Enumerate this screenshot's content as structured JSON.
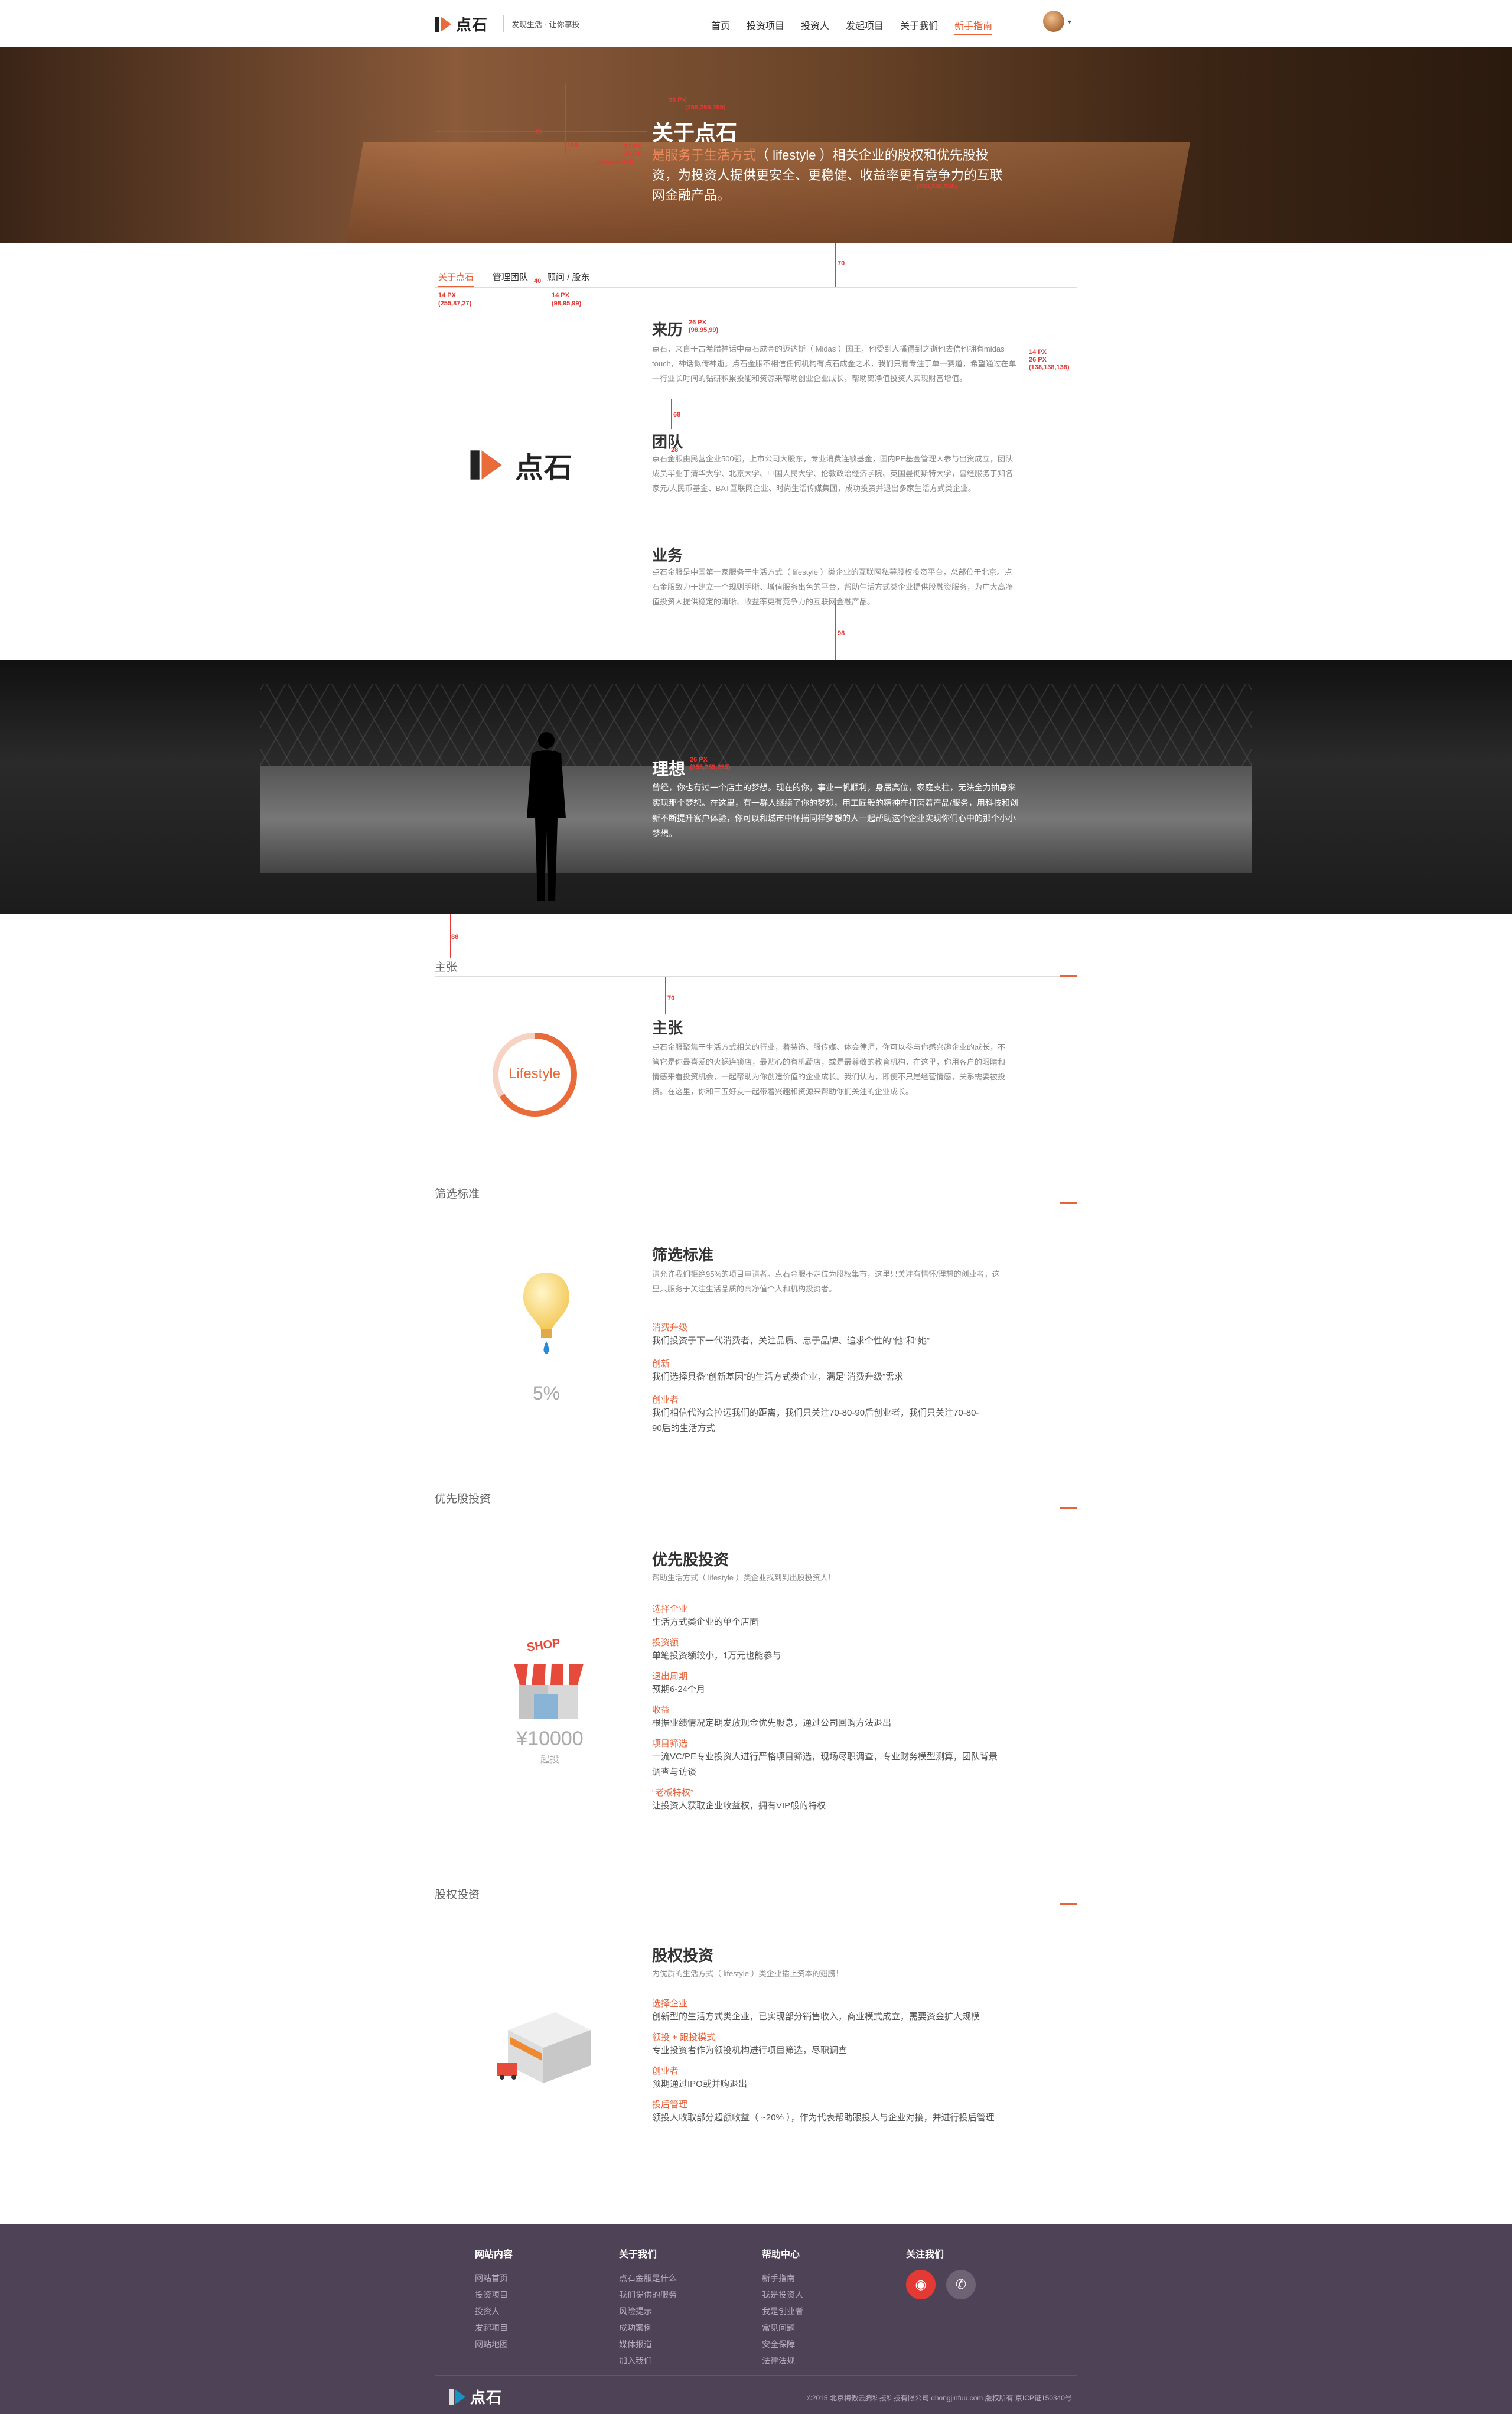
{
  "header": {
    "logo_text": "点石",
    "tagline": "发现生活 · 让你享投",
    "nav": [
      "首页",
      "投资项目",
      "投资人",
      "发起项目",
      "关于我们",
      "新手指南"
    ],
    "active_nav": "新手指南"
  },
  "hero": {
    "title": "关于点石",
    "text_highlight": "是服务于生活方式",
    "text_rest": "（ lifestyle ）相关企业的股权和优先股投资，为投资人提供更安全、更稳健、收益率更有竞争力的互联网金融产品。",
    "notes": [
      "36 PX",
      "(255,255,255)",
      "24 PX",
      "30 PX",
      "(255,194,54)",
      "(255,255,255)",
      "108",
      "76"
    ]
  },
  "subtabs": {
    "items": [
      "关于点石",
      "管理团队",
      "顾问 / 股东"
    ],
    "notes": [
      "14 PX",
      "(255,87,27)",
      "14 PX",
      "(98,95,99)",
      "40",
      "70"
    ]
  },
  "about": {
    "logo_text": "点石",
    "origin_title": "来历",
    "origin_text": "点石，来自于古希腊神话中点石成金的迈达斯（ Midas ）国王，他受到人播得到之逝他去信他拥有midas touch，神话似传神逝。点石金服不相信任何机构有点石成金之术，我们只有专注于单一赛道，希望通过在单一行业长时间的钻研积累投能和资源来帮助创业企业成长，帮助离净值投资人实现财富增值。",
    "team_title": "团队",
    "team_text": "点石金服由民营企业500强，上市公司大股东，专业消费连锁基金，国内PE基金管理人参与出资成立，团队成员毕业于清华大学、北京大学、中国人民大学、伦敦政治经济学院、英国曼彻斯特大学，曾经服务于知名家元/人民币基金、BAT互联网企业、时尚生活传媒集团，成功投资并退出多家生活方式类企业。",
    "business_title": "业务",
    "business_text": "点石金服是中国第一家服务于生活方式（ lifestyle ）类企业的互联网私募股权投资平台，总部位于北京。点石金服致力于建立一个规则明晰、增值服务出色的平台，帮助生活方式类企业提供股融资服务，为广大高净值投资人提供稳定的清晰、收益率更有竞争力的互联网金融产品。",
    "notes": [
      "26 PX",
      "(98,95,99)",
      "14 PX",
      "26 PX",
      "(138,138,138)",
      "68",
      "28",
      "98"
    ]
  },
  "dream": {
    "title": "理想",
    "text": "曾经，你也有过一个店主的梦想。现在的你，事业一帆顺利，身居高位，家庭支柱，无法全力抽身来实现那个梦想。在这里，有一群人继续了你的梦想，用工匠般的精神在打磨着产品/服务，用科技和创新不断提升客户体验，你可以和城市中怀揣同样梦想的人一起帮助这个企业实现你们心中的那个小小梦想。",
    "notes": [
      "26 PX",
      "(255,255,255)",
      "88"
    ]
  },
  "claim": {
    "section_label": "主张",
    "title": "主张",
    "badge": "Lifestyle",
    "text": "点石金服聚焦于生活方式相关的行业，着装饰、服传媒、体会律师，你可以参与你感兴趣企业的成长，不管它是你最喜爱的火锅连锁店，最贴心的有机蔬店，或是最尊敬的教育机构，在这里，你用客户的眼睛和情感来看投资机会，一起帮助为你创造价值的企业成长。我们认为，即使不只是经营情感，关系需要被投资。在这里，你和三五好友一起带着兴趣和资源来帮助你们关注的企业成长。",
    "note": "70"
  },
  "filter": {
    "section_label": "筛选标准",
    "title": "筛选标准",
    "subtitle": "请允许我们拒绝95%的项目申请者。点石金服不定位为股权集市，这里只关注有情怀/理想的创业者，这里只服务于关注生活品质的高净值个人和机构投资者。",
    "percent": "5%",
    "items": [
      {
        "label": "消费升级",
        "text": "我们投资于下一代消费者，关注品质、忠于品牌、追求个性的“他”和“她”"
      },
      {
        "label": "创新",
        "text": "我们选择具备“创新基因”的生活方式类企业，满足“消费升级”需求"
      },
      {
        "label": "创业者",
        "text": "我们相信代沟会拉远我们的距离，我们只关注70-80-90后创业者，我们只关注70-80-90后的生活方式"
      }
    ]
  },
  "preferred": {
    "section_label": "优先股投资",
    "title": "优先股投资",
    "subtitle": "帮助生活方式（ lifestyle ）类企业找到到出股投资人！",
    "shop_sign": "SHOP",
    "amount": "¥10000",
    "amount_sub": "起投",
    "items": [
      {
        "label": "选择企业",
        "text": "生活方式类企业的单个店面"
      },
      {
        "label": "投资额",
        "text": "单笔投资额较小，1万元也能参与"
      },
      {
        "label": "退出周期",
        "text": "预期6-24个月"
      },
      {
        "label": "收益",
        "text": "根据业绩情况定期发放现金优先股息，通过公司回购方法退出"
      },
      {
        "label": "项目筛选",
        "text": "一流VC/PE专业投资人进行严格项目筛选，现场尽职调查，专业财务模型测算，团队背景调查与访谈"
      },
      {
        "label": "“老板特权”",
        "text": "让投资人获取企业收益权，拥有VIP般的特权"
      }
    ]
  },
  "equity": {
    "section_label": "股权投资",
    "title": "股权投资",
    "subtitle": "为优质的生活方式（ lifestyle ）类企业插上资本的翅膀！",
    "items": [
      {
        "label": "选择企业",
        "text": "创新型的生活方式类企业，已实现部分销售收入，商业模式成立，需要资金扩大规模"
      },
      {
        "label": "领投 + 跟投模式",
        "text": "专业投资者作为领投机构进行项目筛选，尽职调查"
      },
      {
        "label": "创业者",
        "text": "预期通过IPO或并购退出"
      },
      {
        "label": "投后管理",
        "text": "领投人收取部分超额收益（ ~20% ），作为代表帮助跟投人与企业对接，并进行投后管理"
      }
    ]
  },
  "footer": {
    "cols": [
      {
        "title": "网站内容",
        "links": [
          "网站首页",
          "投资项目",
          "投资人",
          "发起项目",
          "网站地图"
        ]
      },
      {
        "title": "关于我们",
        "links": [
          "点石金服是什么",
          "我们提供的服务",
          "风险提示",
          "成功案例",
          "媒体报道",
          "加入我们"
        ]
      },
      {
        "title": "帮助中心",
        "links": [
          "新手指南",
          "我是投资人",
          "我是创业者",
          "常见问题",
          "安全保障",
          "法律法规"
        ]
      }
    ],
    "follow_title": "关注我们",
    "logo_text": "点石",
    "copyright": "©2015 北京梅傲云腾科技科技有限公司 dhongjinfuu.com 版权所有 京ICP证150340号"
  },
  "colors": {
    "accent": "#e8623a",
    "footer_bg": "#4e4356",
    "dark_band": "#1c1c1c"
  }
}
